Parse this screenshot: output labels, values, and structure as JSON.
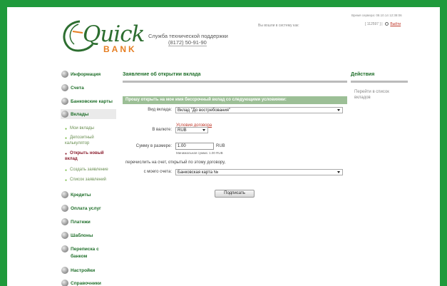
{
  "header": {
    "server_time": "Время сервера: 08.10.14 12:38:06",
    "logged_in": "Вы вошли в систему как:",
    "account_id": "[ 112597 ]",
    "separator": "|",
    "logout": "Выйти",
    "logo_text": "Quick",
    "logo_bank": "BANK",
    "support_title": "Служба технической поддержки",
    "support_phone": "(8172) 50-91-90"
  },
  "sidebar": {
    "items": [
      {
        "label": "Информация"
      },
      {
        "label": "Счета"
      },
      {
        "label": "Банковские карты"
      },
      {
        "label": "Вклады"
      },
      {
        "label": "Кредиты"
      },
      {
        "label": "Оплата услуг"
      },
      {
        "label": "Платежи"
      },
      {
        "label": "Шаблоны"
      },
      {
        "label": "Переписка с"
      },
      {
        "label": "банком"
      },
      {
        "label": "Настройки"
      },
      {
        "label": "Справочники"
      }
    ],
    "sub_items": [
      {
        "label": "Мои вклады"
      },
      {
        "label": "Депозитный"
      },
      {
        "label": "калькулятор"
      },
      {
        "label": "Открыть новый"
      },
      {
        "label": "вклад"
      },
      {
        "label": "Создать заявление"
      },
      {
        "label": "Список заявлений"
      }
    ]
  },
  "main": {
    "title": "Заявление об открытии вклада",
    "bar": "Прошу открыть на мое имя бессрочный вклад со следующими условиями:",
    "deposit_type_label": "Вид вклада:",
    "deposit_type_value": "Вклад \"До востребования\"",
    "terms_link": "Условия договора",
    "currency_label": "В валюте:",
    "currency_value": "RUB",
    "amount_label": "Сумму в размере:",
    "amount_value": "1.00",
    "amount_currency": "RUB",
    "min_amount": "Минимальная сумма: 1.00 RUB",
    "transfer_text": "перечислить на счет, открытый по этому договору,",
    "from_account_label": "с моего счета:",
    "from_account_value": "Банковская карта №",
    "submit": "Подписать"
  },
  "actions": {
    "title": "Действия",
    "link_line1": "Перейти в список",
    "link_line2": "вкладов"
  }
}
